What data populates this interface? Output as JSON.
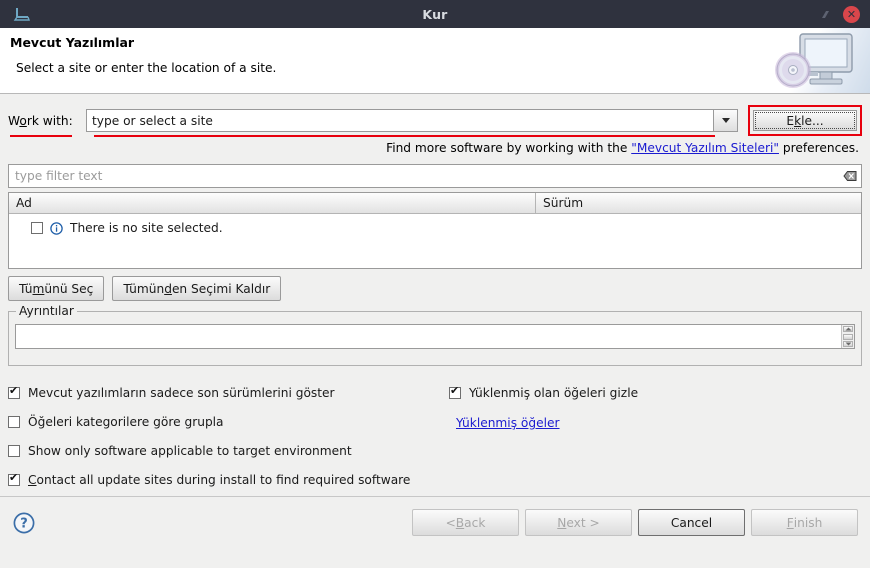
{
  "window": {
    "title": "Kur",
    "app_icon": "laptop-icon",
    "restore_icon": "restore-icon",
    "close_icon": "close-icon"
  },
  "header": {
    "title": "Mevcut Yazılımlar",
    "subtitle": "Select a site or enter the location of a site.",
    "art_icon": "monitor-with-disc-icon"
  },
  "work_with": {
    "label_pre": "W",
    "label_key": "o",
    "label_post": "rk with:",
    "combo_value": "type or select a site",
    "combo_placeholder": "type or select a site",
    "dropdown_icon": "chevron-down-icon",
    "add_button": {
      "pre": "E",
      "key": "k",
      "post": "le..."
    }
  },
  "find_more": {
    "before": "Find more software by working with the ",
    "link": "\"Mevcut Yazılım Siteleri\"",
    "after": " preferences."
  },
  "filter": {
    "placeholder": "type filter text",
    "value": "",
    "clear_icon": "clear-icon"
  },
  "table": {
    "columns": [
      "Ad",
      "Sürüm"
    ],
    "rows": [
      {
        "checked": false,
        "icon": "info-icon",
        "name": "There is no site selected.",
        "version": ""
      }
    ]
  },
  "selection_buttons": {
    "select_all": {
      "pre": "Tü",
      "key": "m",
      "post": "ünü Seç"
    },
    "deselect_all": {
      "pre": "Tümün",
      "key": "d",
      "post": "en Seçimi Kaldır"
    }
  },
  "details": {
    "legend": "Ayrıntılar",
    "text": "",
    "scroll_up_icon": "scroll-up-icon",
    "scroll_down_icon": "scroll-down-icon"
  },
  "options": {
    "left": [
      {
        "checked": true,
        "label": "Mevcut yazılımların sadece son sürümlerini göster"
      },
      {
        "checked": false,
        "label": "Öğeleri kategorilere göre grupla"
      },
      {
        "checked": false,
        "label": "Show only software applicable to target environment"
      },
      {
        "checked": true,
        "label_pre": "",
        "label_key": "C",
        "label_post": "ontact all update sites during install to find required software"
      }
    ],
    "right": {
      "checkbox": {
        "checked": true,
        "label": "Yüklenmiş olan öğeleri gizle"
      },
      "link": "Yüklenmiş öğeler"
    }
  },
  "footer": {
    "help_icon": "help-icon",
    "buttons": [
      {
        "pre": "< ",
        "key": "B",
        "post": "ack",
        "enabled": false,
        "primary": false
      },
      {
        "pre": "",
        "key": "N",
        "post": "ext >",
        "enabled": false,
        "primary": false
      },
      {
        "pre": "Cancel",
        "key": "",
        "post": "",
        "enabled": true,
        "primary": true
      },
      {
        "pre": "",
        "key": "F",
        "post": "inish",
        "enabled": false,
        "primary": false
      }
    ]
  },
  "colors": {
    "titlebar": "#2f323e",
    "close_red": "#d9464b",
    "annotation_red": "#e8000d",
    "link_blue": "#1b1bd0",
    "info_blue": "#1f5fa9",
    "dialog_bg": "#f0f0ef"
  }
}
